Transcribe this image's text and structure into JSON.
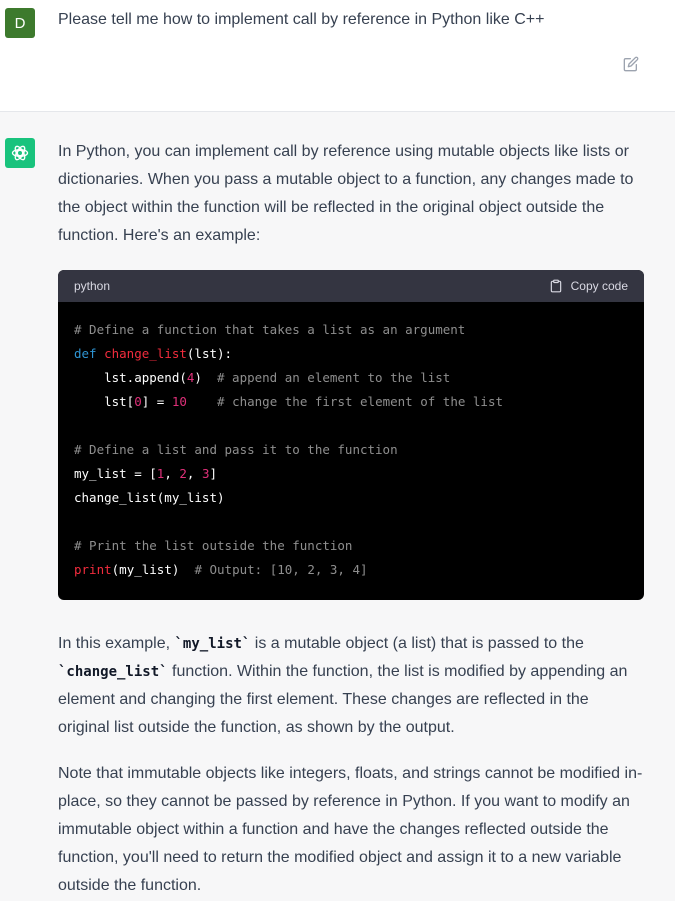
{
  "user": {
    "avatar_letter": "D",
    "message": "Please tell me how to implement call by reference in Python like C++"
  },
  "assistant": {
    "intro": "In Python, you can implement call by reference using mutable objects like lists or dictionaries. When you pass a mutable object to a function, any changes made to the object within the function will be reflected in the original object outside the function. Here's an example:",
    "code": {
      "language": "python",
      "copy_label": "Copy code",
      "lines": [
        "# Define a function that takes a list as an argument",
        "def change_list(lst):",
        "    lst.append(4)  # append an element to the list",
        "    lst[0] = 10    # change the first element of the list",
        "",
        "# Define a list and pass it to the function",
        "my_list = [1, 2, 3]",
        "change_list(my_list)",
        "",
        "# Print the list outside the function",
        "print(my_list)  # Output: [10, 2, 3, 4]"
      ]
    },
    "para2": {
      "t1": "In this example, ",
      "code1": "`my_list`",
      "t2": " is a mutable object (a list) that is passed to the ",
      "code2": "`change_list`",
      "t3": " function. Within the function, the list is modified by appending an element and changing the first element. These changes are reflected in the original list outside the function, as shown by the output."
    },
    "para3": "Note that immutable objects like integers, floats, and strings cannot be modified in-place, so they cannot be passed by reference in Python. If you want to modify an immutable object within a function and have the changes reflected outside the function, you'll need to return the modified object and assign it to a new variable outside the function."
  },
  "colors": {
    "user_avatar": "#3d7a2d",
    "bot_avatar": "#19c37d",
    "code_bg": "#000000",
    "code_header_bg": "#343541"
  }
}
